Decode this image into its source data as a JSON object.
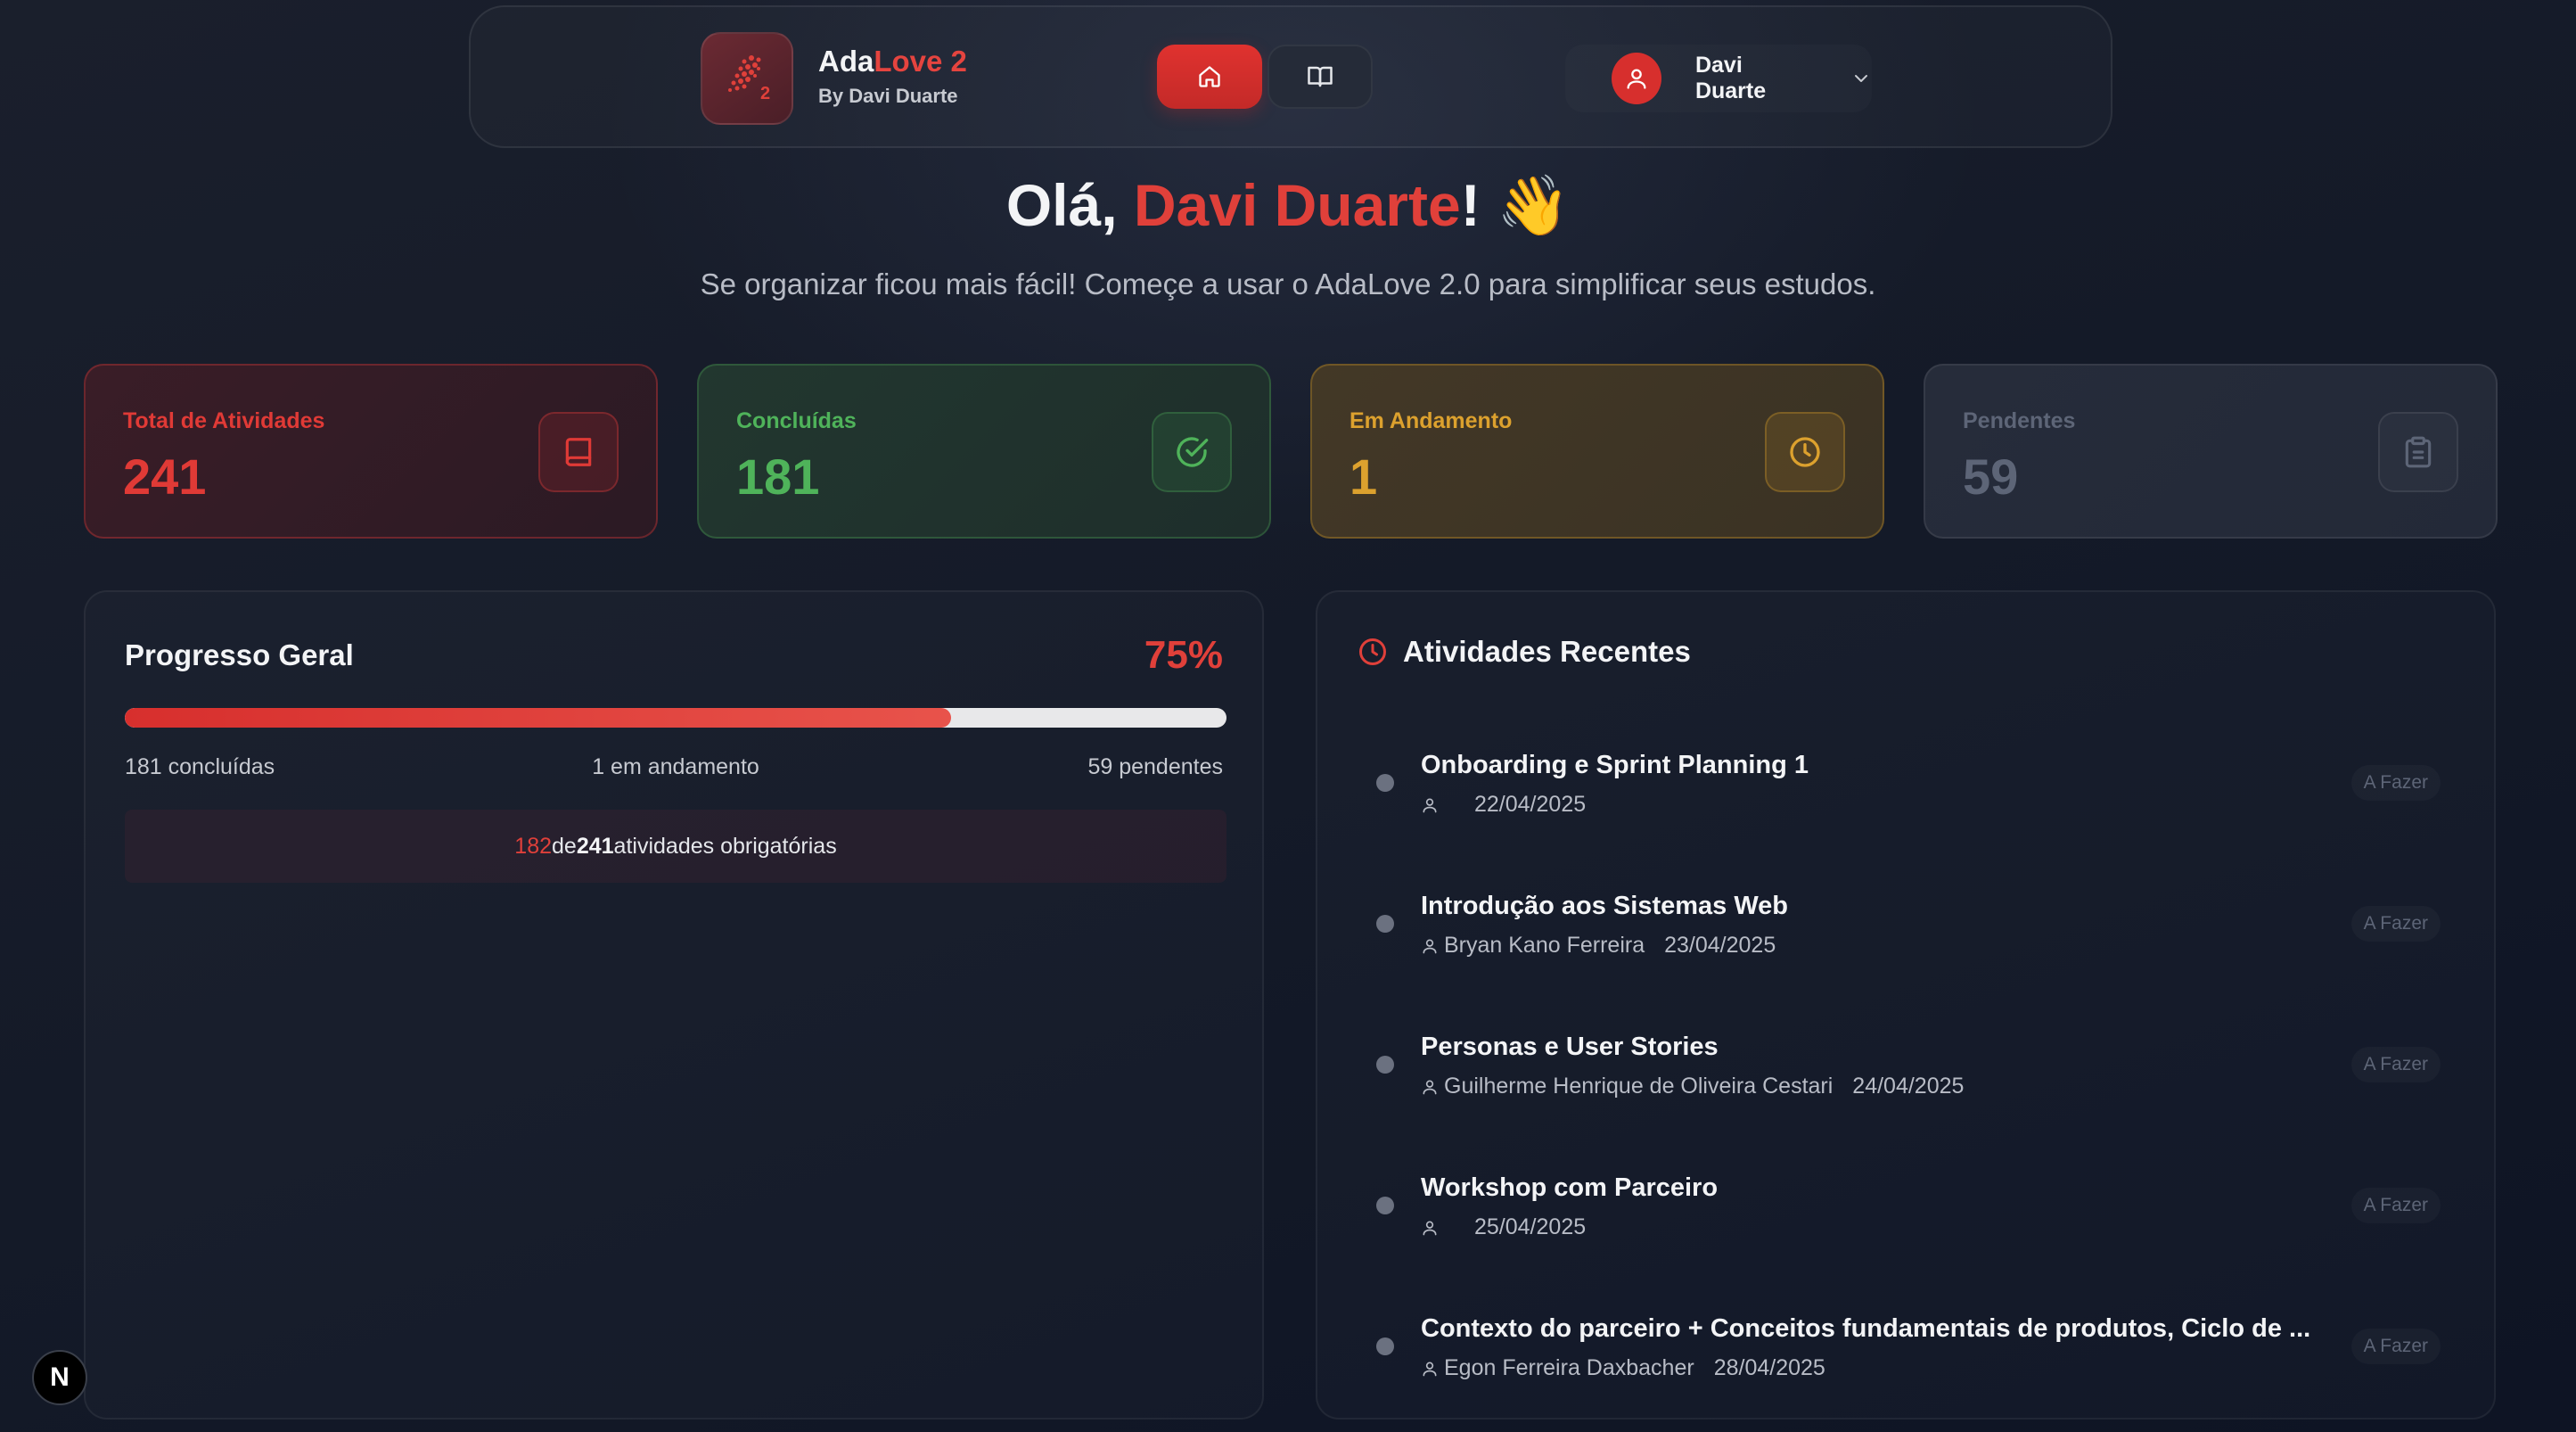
{
  "header": {
    "brand_name_a": "Ada",
    "brand_name_b": "Love 2",
    "brand_by": "By Davi Duarte",
    "logo_badge": "2",
    "nav": [
      {
        "icon": "home-icon",
        "active": true
      },
      {
        "icon": "book-open-icon",
        "active": false
      }
    ],
    "user_name": "Davi Duarte"
  },
  "greeting": {
    "prefix": "Olá, ",
    "name": "Davi Duarte",
    "suffix": "! 👋",
    "subtitle": "Se organizar ficou mais fácil! Começe a usar o AdaLove 2.0 para simplificar seus estudos."
  },
  "stats": {
    "total": {
      "label": "Total de Atividades",
      "value": "241",
      "icon": "book-icon",
      "color": "#e03a36"
    },
    "done": {
      "label": "Concluídas",
      "value": "181",
      "icon": "check-circle-icon",
      "color": "#4fb35a"
    },
    "in_progress": {
      "label": "Em Andamento",
      "value": "1",
      "icon": "clock-icon",
      "color": "#dca12e"
    },
    "pending": {
      "label": "Pendentes",
      "value": "59",
      "icon": "clipboard-icon",
      "color": "#5d6577"
    }
  },
  "progress": {
    "title": "Progresso Geral",
    "percent_label": "75%",
    "fill_fraction": 0.75,
    "done_text": "181 concluídas",
    "in_progress_text": "1 em andamento",
    "pending_text": "59 pendentes",
    "summary_count": "182",
    "summary_of": " de ",
    "summary_total": "241",
    "summary_rest": " atividades obrigatórias"
  },
  "recent": {
    "title": "Atividades Recentes",
    "items": [
      {
        "name": "Onboarding e Sprint Planning 1",
        "person": "",
        "date": "22/04/2025",
        "status": "A Fazer"
      },
      {
        "name": "Introdução aos Sistemas Web",
        "person": "Bryan Kano Ferreira",
        "date": "23/04/2025",
        "status": "A Fazer"
      },
      {
        "name": "Personas e User Stories",
        "person": "Guilherme Henrique de Oliveira Cestari",
        "date": "24/04/2025",
        "status": "A Fazer"
      },
      {
        "name": "Workshop com Parceiro",
        "person": "",
        "date": "25/04/2025",
        "status": "A Fazer"
      },
      {
        "name": "Contexto do parceiro + Conceitos fundamentais de produtos, Ciclo de ...",
        "person": "Egon Ferreira Daxbacher",
        "date": "28/04/2025",
        "status": "A Fazer"
      }
    ]
  },
  "dev_badge": "N"
}
